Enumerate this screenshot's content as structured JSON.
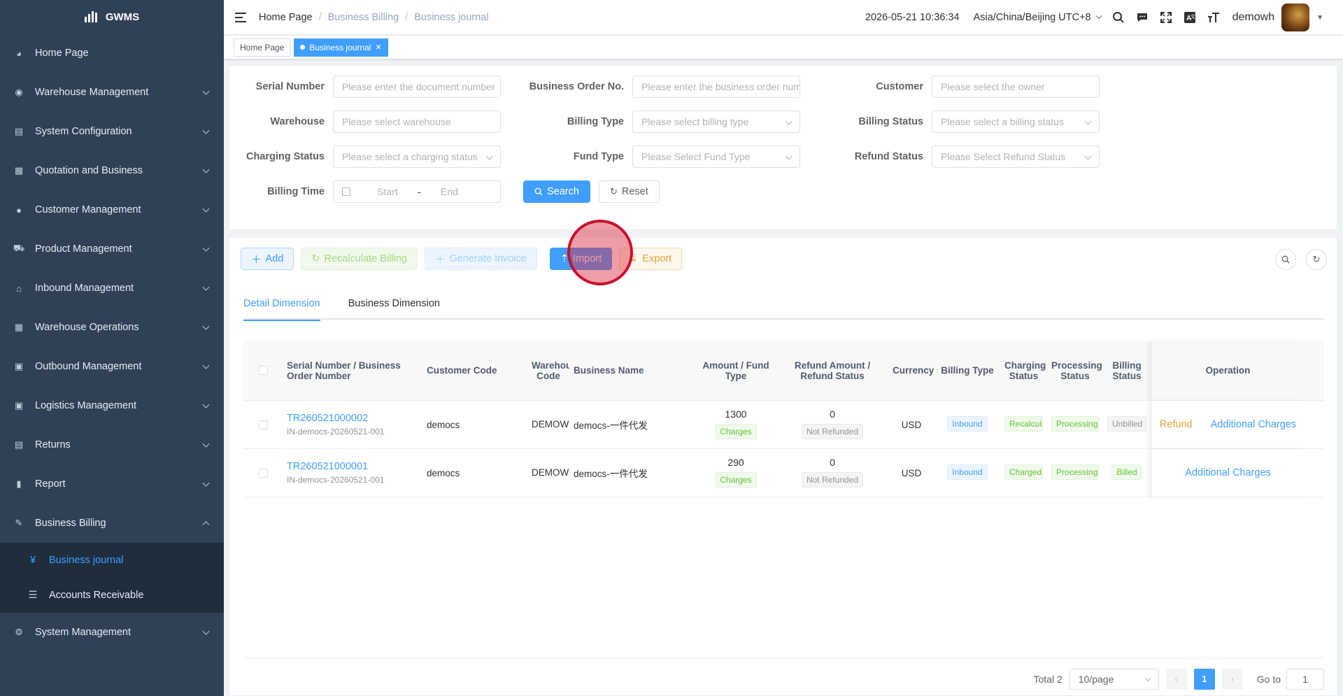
{
  "app": {
    "logo_text": "GWMS"
  },
  "sidebar": {
    "items": [
      {
        "label": "Home Page",
        "icon": "dashboard-icon"
      },
      {
        "label": "Warehouse Management",
        "icon": "globe-icon"
      },
      {
        "label": "System Configuration",
        "icon": "config-icon"
      },
      {
        "label": "Quotation and Business",
        "icon": "document-icon"
      },
      {
        "label": "Customer Management",
        "icon": "user-icon"
      },
      {
        "label": "Product Management",
        "icon": "cart-icon"
      },
      {
        "label": "Inbound Management",
        "icon": "home-icon"
      },
      {
        "label": "Warehouse Operations",
        "icon": "grid-icon"
      },
      {
        "label": "Outbound Management",
        "icon": "apps-icon"
      },
      {
        "label": "Logistics Management",
        "icon": "apps-icon"
      },
      {
        "label": "Returns",
        "icon": "document-icon"
      },
      {
        "label": "Report",
        "icon": "chart-icon"
      },
      {
        "label": "Business Billing",
        "icon": "edit-icon"
      }
    ],
    "submenu": [
      {
        "label": "Business journal",
        "icon": "yen-icon"
      },
      {
        "label": "Accounts Receivable",
        "icon": "list-icon"
      }
    ],
    "footer_item": {
      "label": "System Management",
      "icon": "gear-icon"
    }
  },
  "header": {
    "breadcrumb": [
      "Home Page",
      "Business Billing",
      "Business journal"
    ],
    "datetime": "2026-05-21 10:36:34",
    "timezone": "Asia/China/Beijing UTC+8",
    "username": "demowh"
  },
  "tags": [
    {
      "label": "Home Page"
    },
    {
      "label": "Business journal"
    }
  ],
  "filters": {
    "serial_number": {
      "label": "Serial Number",
      "placeholder": "Please enter the document number"
    },
    "business_order_no": {
      "label": "Business Order No.",
      "placeholder": "Please enter the business order number"
    },
    "customer": {
      "label": "Customer",
      "placeholder": "Please select the owner"
    },
    "warehouse": {
      "label": "Warehouse",
      "placeholder": "Please select warehouse"
    },
    "billing_type": {
      "label": "Billing Type",
      "placeholder": "Please select billing type"
    },
    "billing_status": {
      "label": "Billing Status",
      "placeholder": "Please select a billing status"
    },
    "charging_status": {
      "label": "Charging Status",
      "placeholder": "Please select a charging status"
    },
    "fund_type": {
      "label": "Fund Type",
      "placeholder": "Please Select Fund Type"
    },
    "refund_status": {
      "label": "Refund Status",
      "placeholder": "Please Select Refund Status"
    },
    "billing_time": {
      "label": "Billing Time",
      "start": "Start",
      "sep": "-",
      "end": "End"
    },
    "search_label": "Search",
    "reset_label": "Reset"
  },
  "toolbar": {
    "add": "Add",
    "recalc": "Recalculate Billing",
    "generate": "Generate Invoice",
    "import": "Import",
    "export": "Export"
  },
  "tabs": [
    "Detail Dimension",
    "Business Dimension"
  ],
  "table": {
    "headers": {
      "serial": "Serial Number / Business Order Number",
      "customer_code": "Customer Code",
      "warehouse_code": "Warehouse Code",
      "business_name": "Business Name",
      "amount": "Amount / Fund Type",
      "refund": "Refund Amount / Refund Status",
      "currency": "Currency",
      "billing_type": "Billing Type",
      "charging_status": "Charging Status",
      "processing_status": "Processing Status",
      "billing_status": "Billing Status",
      "operation": "Operation"
    },
    "rows": [
      {
        "serial": "TR260521000002",
        "order": "IN-democs-20260521-001",
        "customer_code": "democs",
        "warehouse_code": "DEMOWH",
        "business_name": "democs-一件代发",
        "amount": "1300",
        "fund_type": "Charges",
        "refund_amount": "0",
        "refund_status": "Not Refunded",
        "currency": "USD",
        "billing_type": "Inbound",
        "charging_status": "Recalculate",
        "processing_status": "Processing",
        "billing_status": "Unbilled",
        "op_refund": "Refund",
        "op_additional": "Additional Charges"
      },
      {
        "serial": "TR260521000001",
        "order": "IN-democs-20260521-001",
        "customer_code": "democs",
        "warehouse_code": "DEMOWH",
        "business_name": "democs-一件代发",
        "amount": "290",
        "fund_type": "Charges",
        "refund_amount": "0",
        "refund_status": "Not Refunded",
        "currency": "USD",
        "billing_type": "Inbound",
        "charging_status": "Charged",
        "processing_status": "Processing",
        "billing_status": "Billed",
        "op_refund": "",
        "op_additional": "Additional Charges"
      }
    ]
  },
  "pagination": {
    "total_label": "Total 2",
    "page_size": "10/page",
    "current_page": "1",
    "goto_label": "Go to",
    "goto_value": "1"
  },
  "colors": {
    "sidebar_bg": "#304156",
    "accent": "#409eff",
    "success": "#67c23a",
    "warning": "#e6a23c"
  }
}
